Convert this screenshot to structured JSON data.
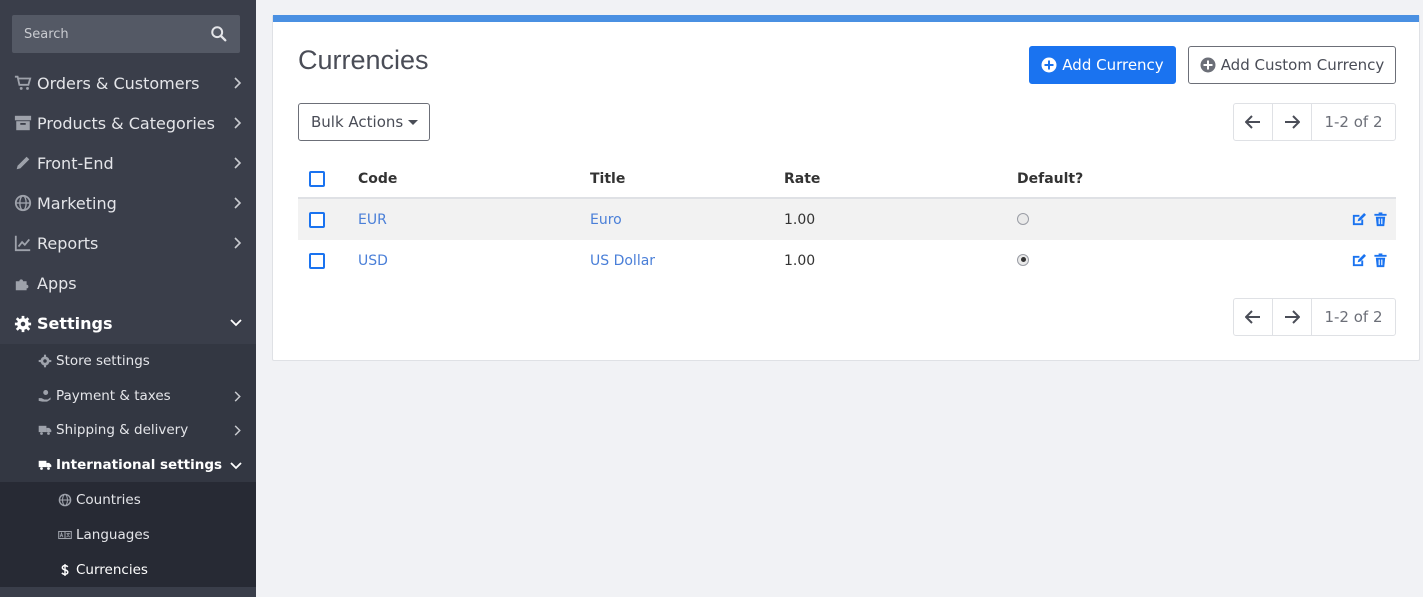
{
  "sidebar": {
    "search_placeholder": "Search",
    "nav": [
      {
        "label": "Orders & Customers",
        "icon": "cart-icon"
      },
      {
        "label": "Products & Categories",
        "icon": "archive-icon"
      },
      {
        "label": "Front-End",
        "icon": "pencil-icon"
      },
      {
        "label": "Marketing",
        "icon": "globe-icon"
      },
      {
        "label": "Reports",
        "icon": "chart-line-icon"
      },
      {
        "label": "Apps",
        "icon": "puzzle-icon"
      },
      {
        "label": "Settings",
        "icon": "gear-icon"
      }
    ],
    "settings_sub": [
      {
        "label": "Store settings",
        "icon": "gear-icon"
      },
      {
        "label": "Payment & taxes",
        "icon": "hand-coin-icon"
      },
      {
        "label": "Shipping & delivery",
        "icon": "truck-icon"
      },
      {
        "label": "International settings",
        "icon": "truck-icon"
      }
    ],
    "international_sub": [
      {
        "label": "Countries",
        "icon": "globe-icon"
      },
      {
        "label": "Languages",
        "icon": "language-icon"
      },
      {
        "label": "Currencies",
        "icon": "dollar-icon"
      }
    ]
  },
  "main": {
    "title": "Currencies",
    "add_button": "Add Currency",
    "add_custom_button": "Add Custom Currency",
    "bulk_actions": "Bulk Actions",
    "pagination_info": "1-2 of 2",
    "table": {
      "headers": {
        "code": "Code",
        "title": "Title",
        "rate": "Rate",
        "default": "Default?"
      },
      "rows": [
        {
          "code": "EUR",
          "title": "Euro",
          "rate": "1.00",
          "is_default": false
        },
        {
          "code": "USD",
          "title": "US Dollar",
          "rate": "1.00",
          "is_default": true
        }
      ]
    }
  },
  "colors": {
    "sidebar_bg": "#3a3e4a",
    "primary": "#1a73f0",
    "link": "#4a7fd8",
    "accent_bar": "#4a90e2"
  }
}
